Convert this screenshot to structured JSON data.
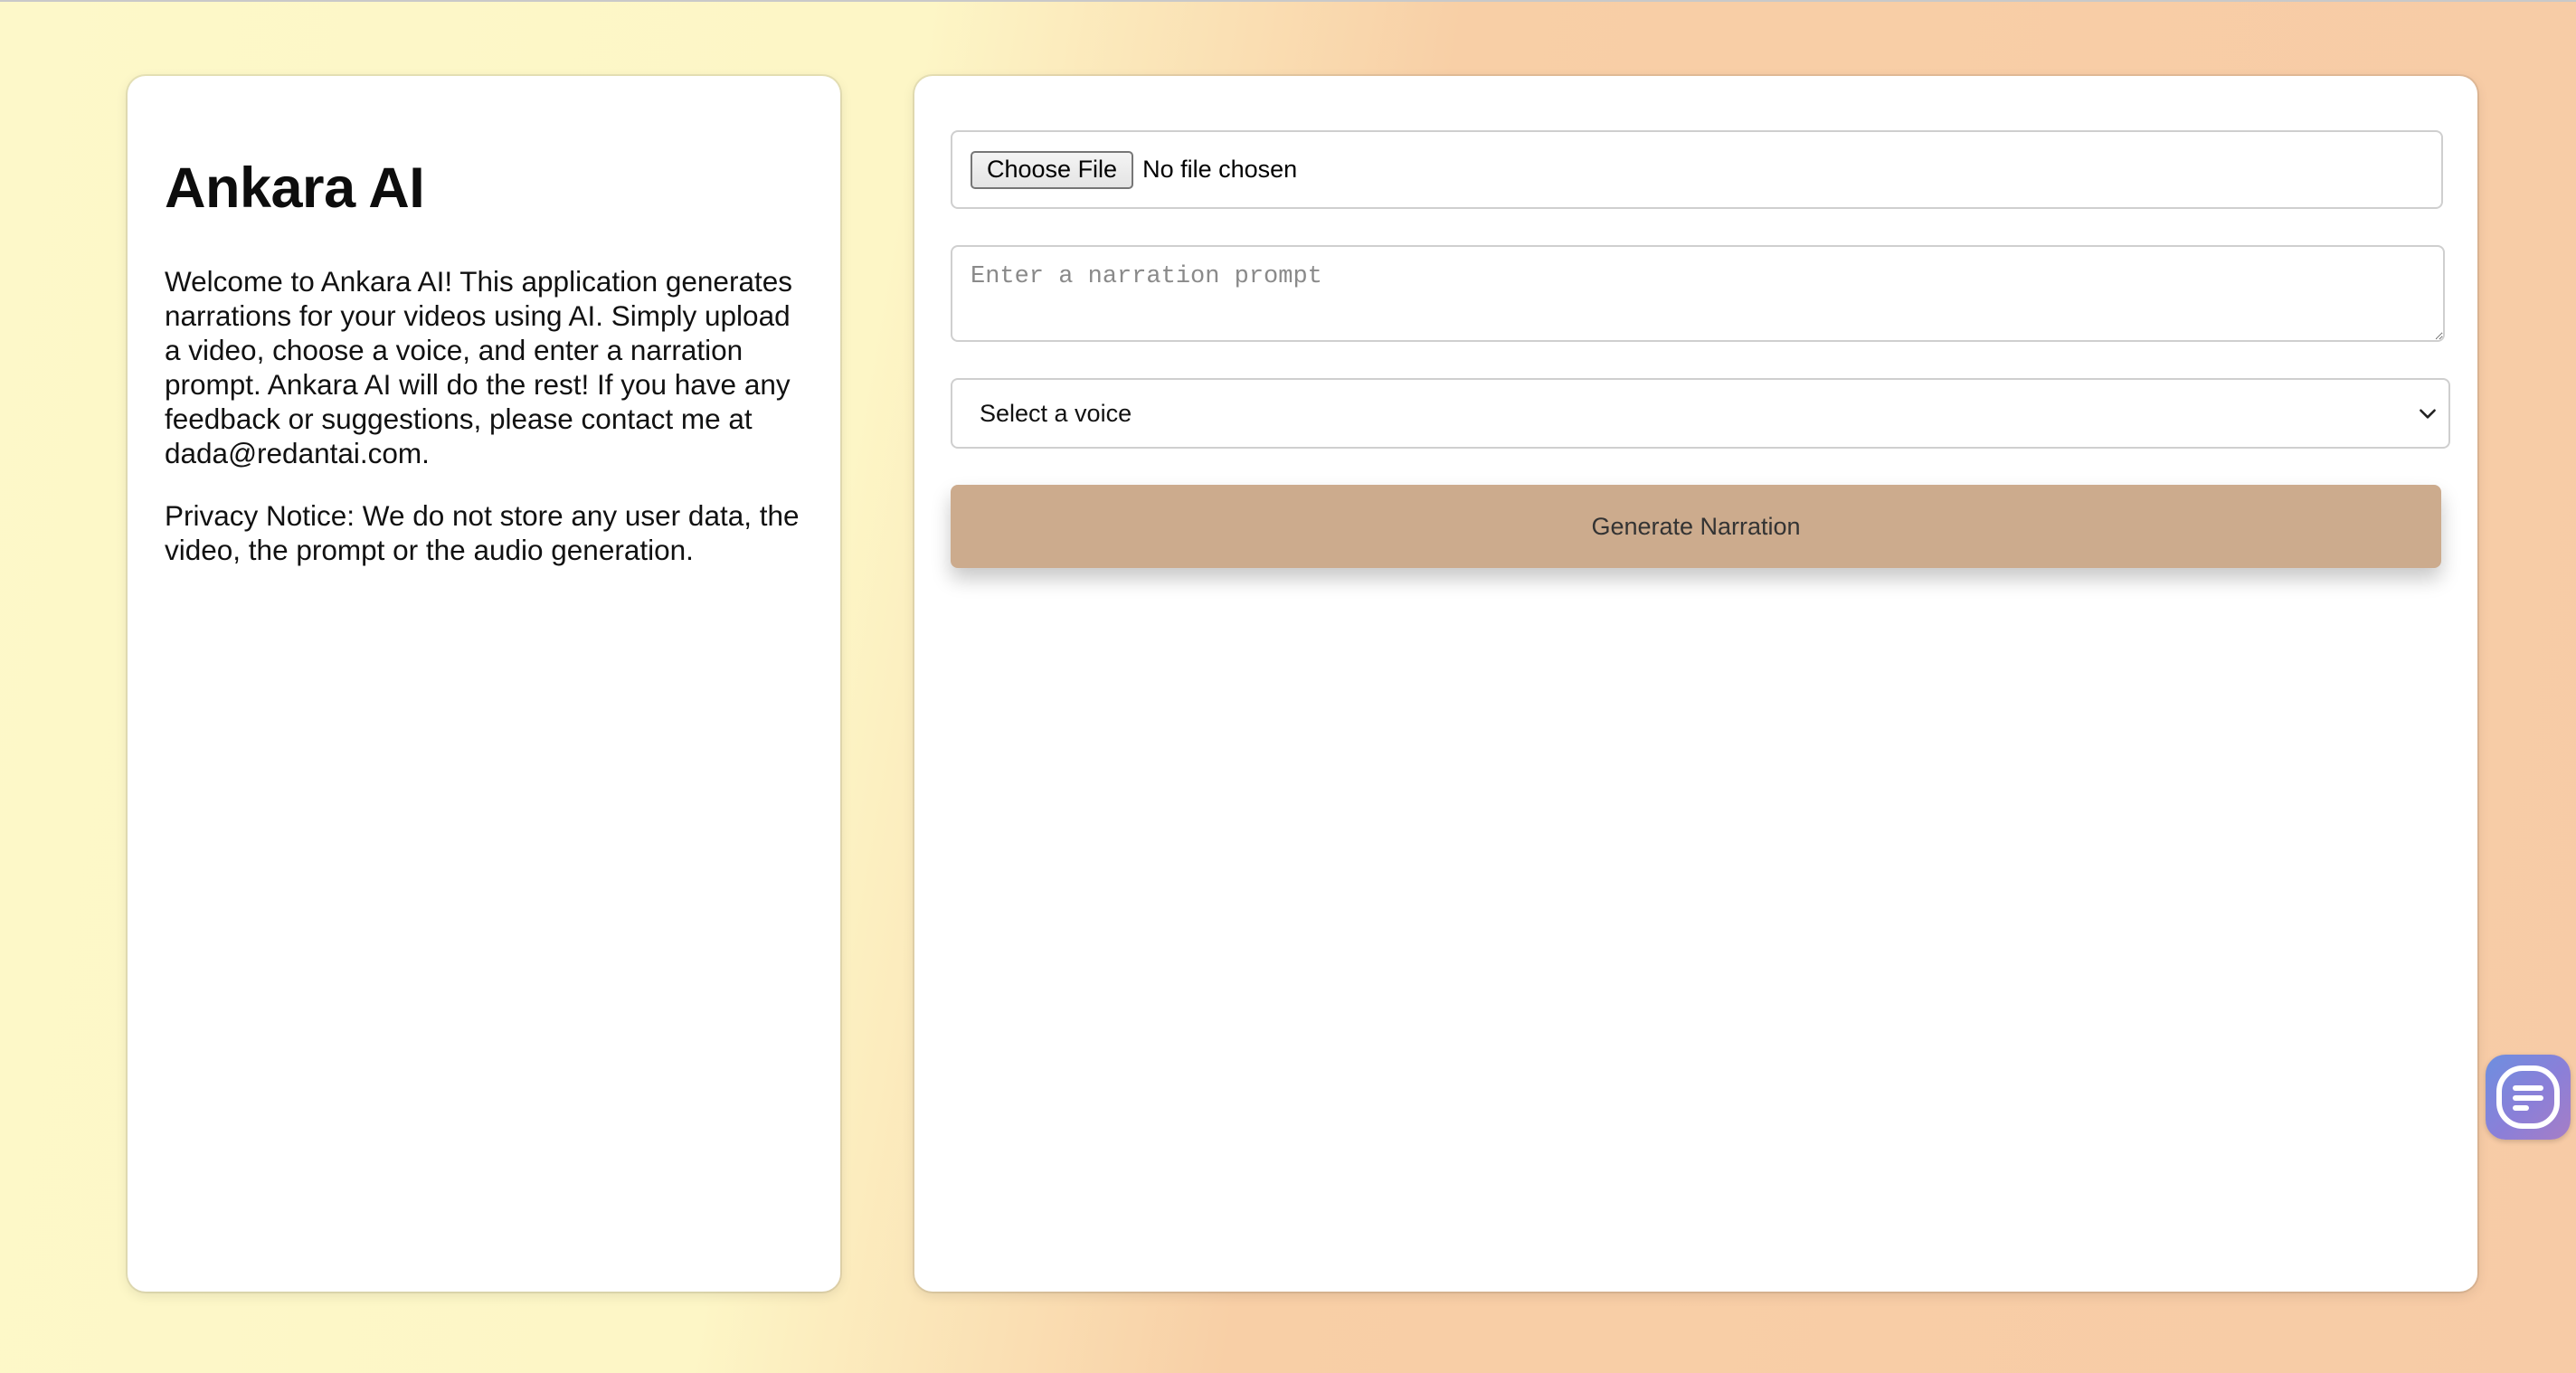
{
  "sidebar": {
    "title": "Ankara AI",
    "intro": "Welcome to Ankara AI! This application generates narrations for your videos using AI. Simply upload a video, choose a voice, and enter a narration prompt. Ankara AI will do the rest! If you have any feedback or suggestions, please contact me at dada@redantai.com.",
    "privacy": "Privacy Notice: We do not store any user data, the video, the prompt or the audio generation."
  },
  "form": {
    "file_button_label": "Choose File",
    "file_status": "No file chosen",
    "prompt_value": "",
    "prompt_placeholder": "Enter a narration prompt",
    "voice_selected": "Select a voice",
    "voice_icon": "chevron-down-icon",
    "generate_label": "Generate Narration"
  },
  "chat_widget": {
    "icon": "chat-icon"
  },
  "colors": {
    "background_start": "#fdf8c9",
    "background_end": "#f7cba6",
    "card": "#ffffff",
    "button": "#ccab8d",
    "chat_widget_start": "#6d8fe0",
    "chat_widget_end": "#a67ec6"
  }
}
